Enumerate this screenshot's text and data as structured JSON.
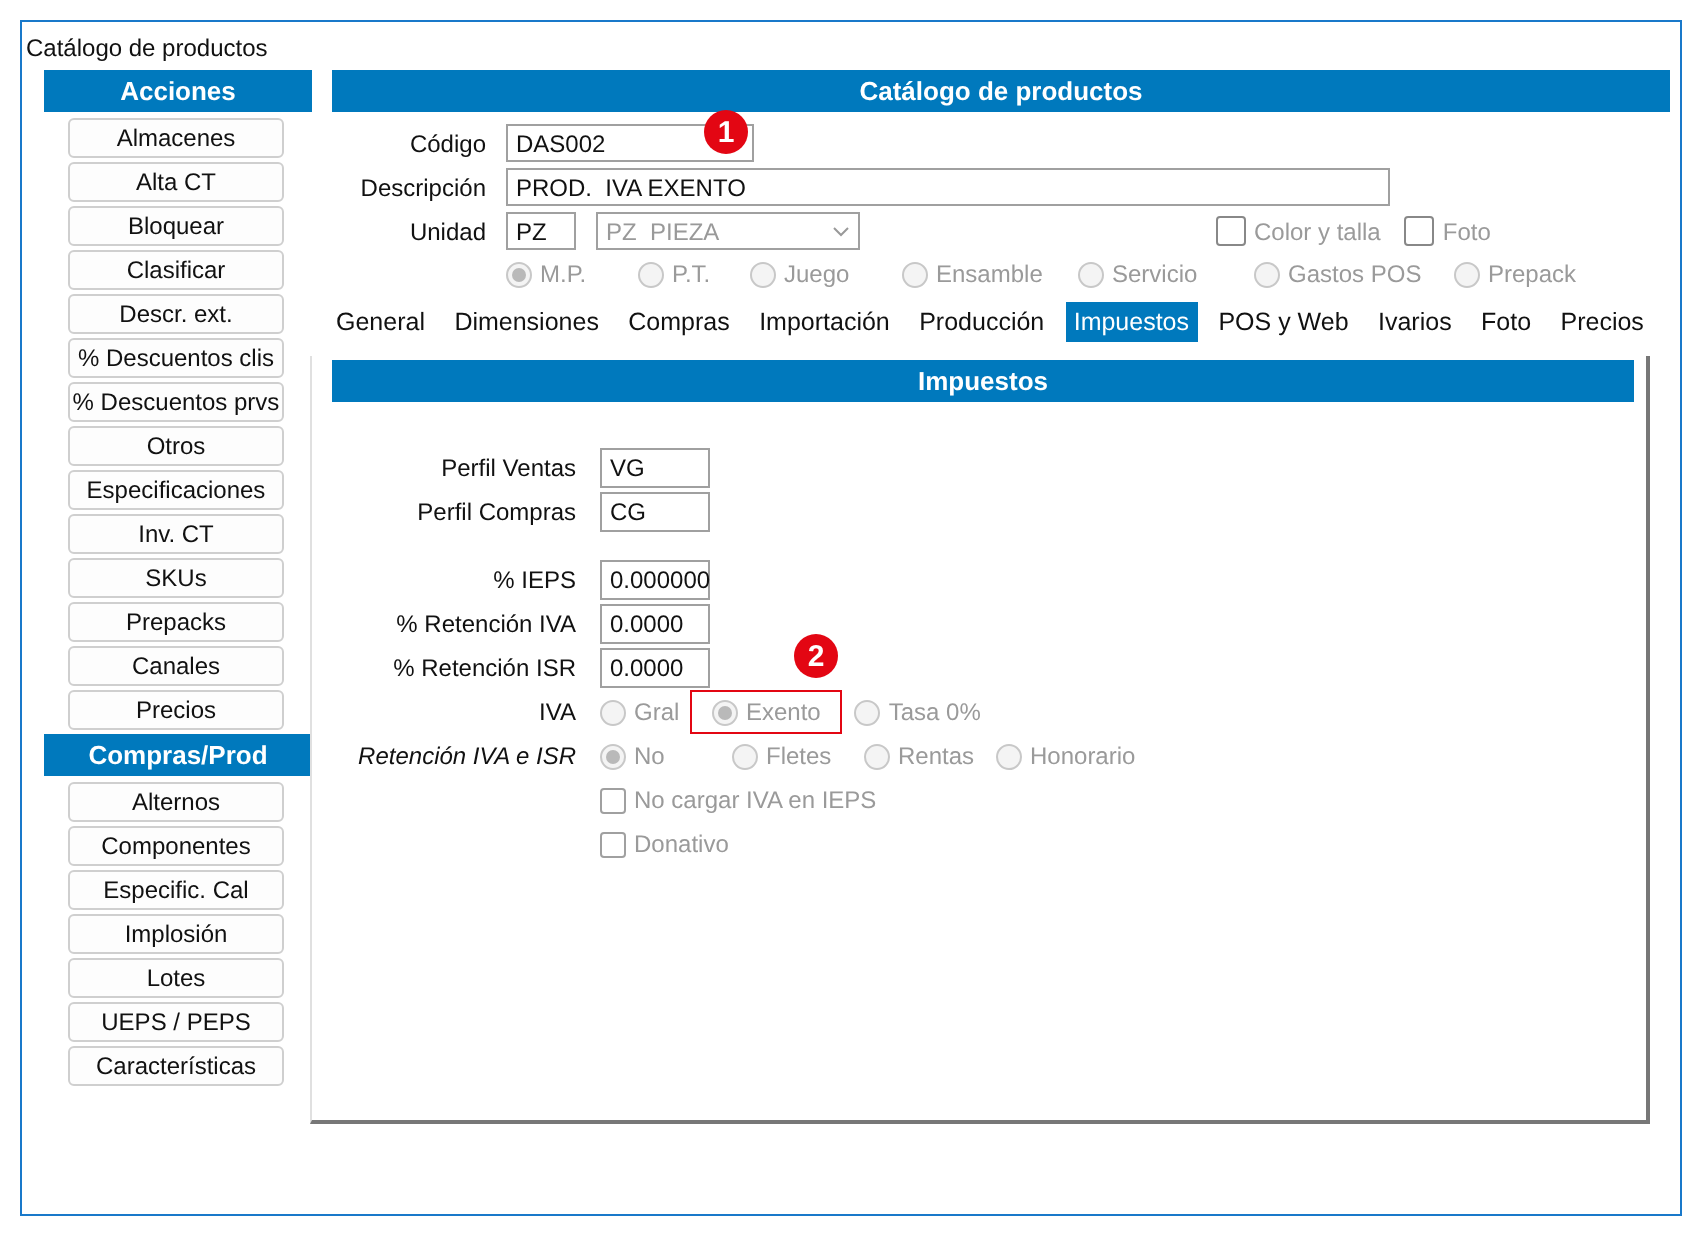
{
  "window": {
    "title": "Catálogo de productos"
  },
  "sidebar": {
    "sections": [
      {
        "title": "Acciones",
        "buttons": [
          "Almacenes",
          "Alta CT",
          "Bloquear",
          "Clasificar",
          "Descr. ext.",
          "%  Descuentos clis",
          "%  Descuentos prvs",
          "Otros",
          "Especificaciones",
          "Inv. CT",
          "SKUs",
          "Prepacks",
          "Canales",
          "Precios"
        ]
      },
      {
        "title": "Compras/Prod",
        "buttons": [
          "Alternos",
          "Componentes",
          "Especific. Cal",
          "Implosión",
          "Lotes",
          "UEPS / PEPS",
          "Características"
        ]
      }
    ]
  },
  "main": {
    "header": "Catálogo de productos",
    "codigo": {
      "label": "Código",
      "value": "DAS002",
      "callout": "1"
    },
    "descripcion": {
      "label": "Descripción",
      "value": "PROD.  IVA EXENTO"
    },
    "unidad": {
      "label": "Unidad",
      "value": "PZ",
      "select": "PZ  PIEZA"
    },
    "checkboxes": [
      {
        "label": "Color y talla",
        "checked": false
      },
      {
        "label": "Foto",
        "checked": false
      }
    ],
    "product_types": [
      {
        "label": "M.P.",
        "selected": true
      },
      {
        "label": "P.T.",
        "selected": false
      },
      {
        "label": "Juego",
        "selected": false
      },
      {
        "label": "Ensamble",
        "selected": false
      },
      {
        "label": "Servicio",
        "selected": false
      },
      {
        "label": "Gastos POS",
        "selected": false
      },
      {
        "label": "Prepack",
        "selected": false
      }
    ],
    "tabs": [
      {
        "label": "General",
        "selected": false
      },
      {
        "label": "Dimensiones",
        "selected": false
      },
      {
        "label": "Compras",
        "selected": false
      },
      {
        "label": "Importación",
        "selected": false
      },
      {
        "label": "Producción",
        "selected": false
      },
      {
        "label": "Impuestos",
        "selected": true
      },
      {
        "label": "POS y Web",
        "selected": false
      },
      {
        "label": "Ivarios",
        "selected": false
      },
      {
        "label": "Foto",
        "selected": false
      },
      {
        "label": "Precios",
        "selected": false
      }
    ]
  },
  "impuestos": {
    "header": "Impuestos",
    "profiles": [
      {
        "label": "Perfil Ventas",
        "value": "VG"
      },
      {
        "label": "Perfil Compras",
        "value": "CG"
      }
    ],
    "rates": [
      {
        "label": "% IEPS",
        "value": "0.000000"
      },
      {
        "label": "% Retención IVA",
        "value": "0.0000"
      },
      {
        "label": "% Retención ISR",
        "value": "0.0000"
      }
    ],
    "iva": {
      "label": "IVA",
      "callout": "2",
      "options": [
        {
          "label": "Gral",
          "selected": false,
          "highlighted": false
        },
        {
          "label": "Exento",
          "selected": true,
          "highlighted": true
        },
        {
          "label": "Tasa 0%",
          "selected": false,
          "highlighted": false
        }
      ]
    },
    "retencion": {
      "label": "Retención IVA e ISR",
      "options": [
        {
          "label": "No",
          "selected": true
        },
        {
          "label": "Fletes",
          "selected": false
        },
        {
          "label": "Rentas",
          "selected": false
        },
        {
          "label": "Honorario",
          "selected": false
        }
      ]
    },
    "checkboxes": [
      {
        "label": "No cargar IVA en IEPS",
        "checked": false
      },
      {
        "label": "Donativo",
        "checked": false
      }
    ]
  }
}
